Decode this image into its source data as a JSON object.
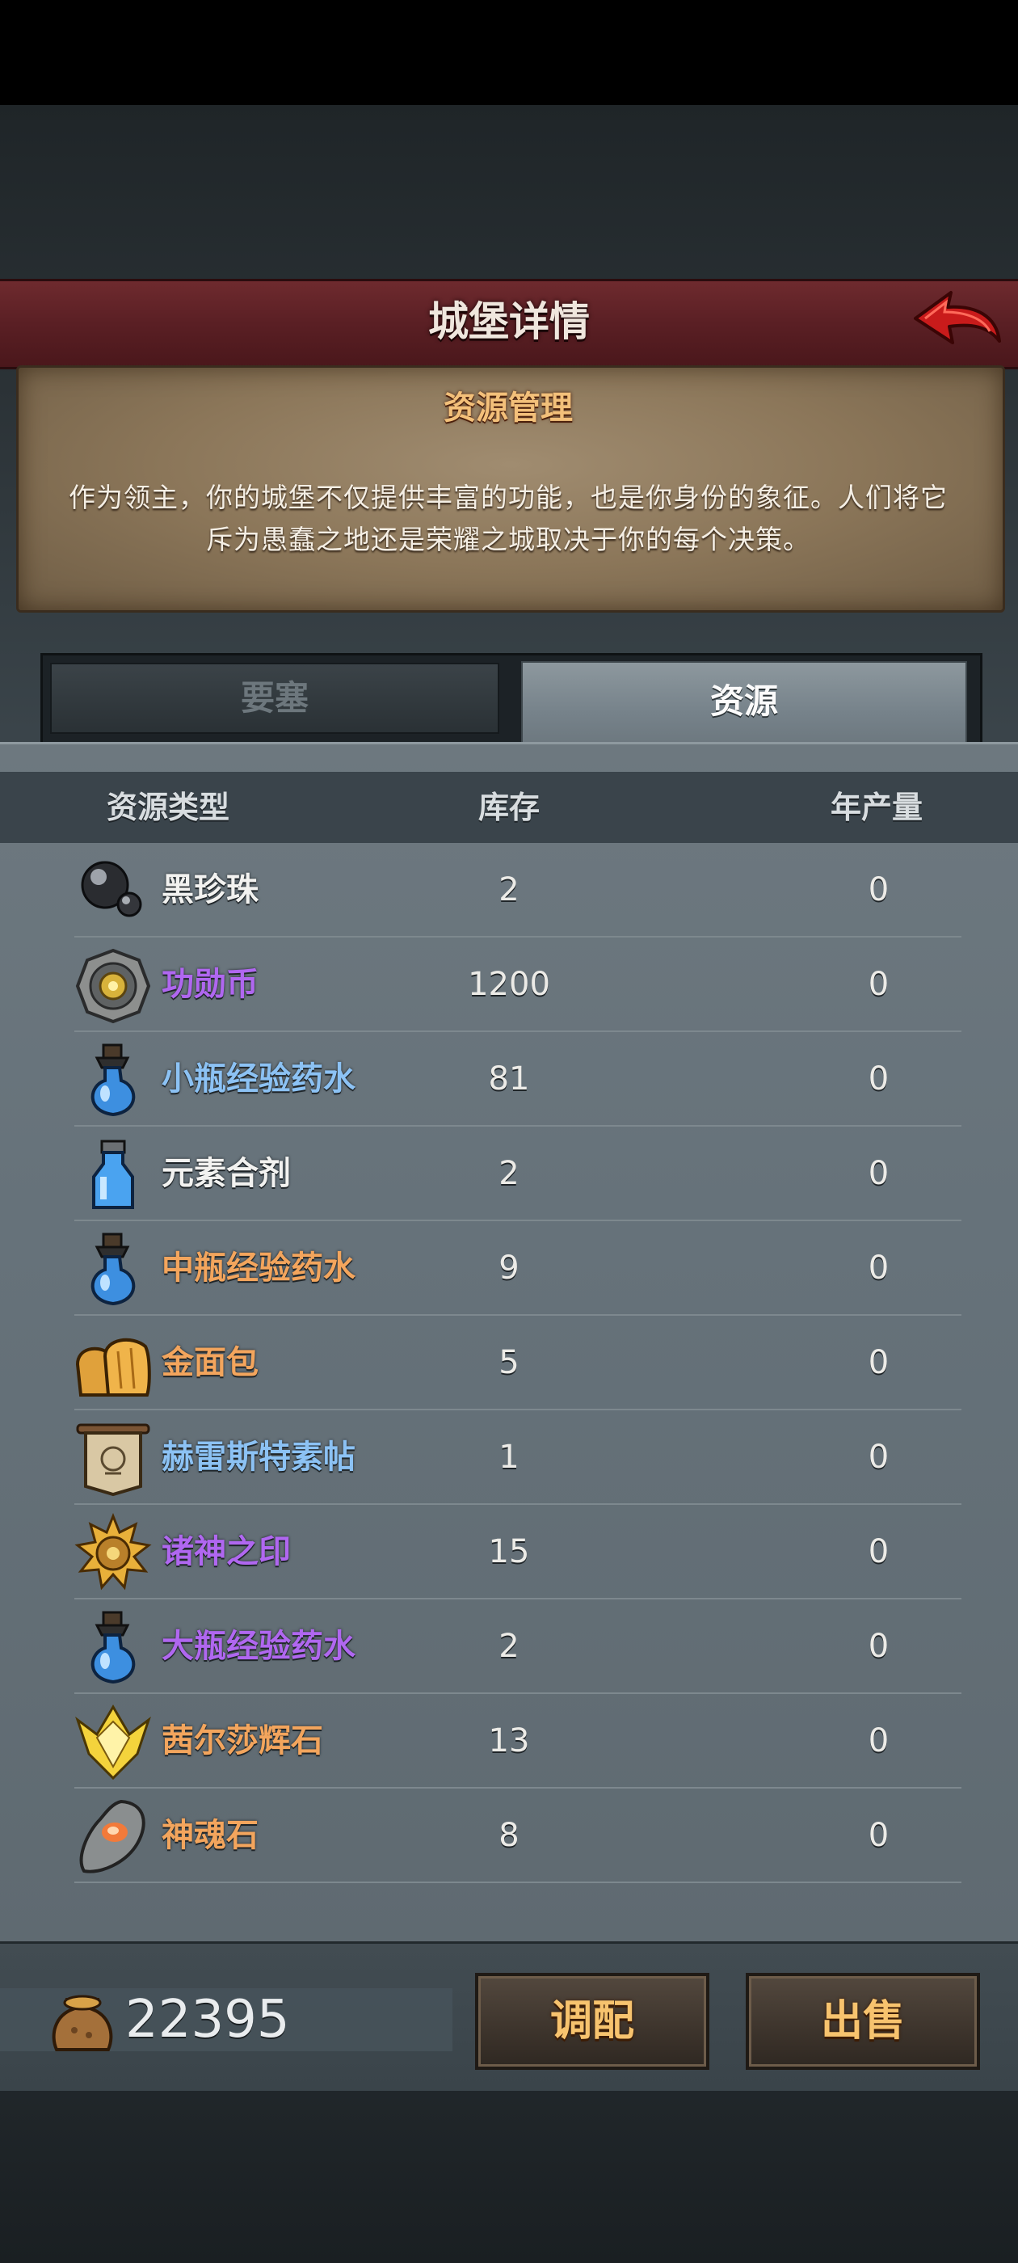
{
  "header": {
    "title": "城堡详情"
  },
  "info_panel": {
    "heading": "资源管理",
    "description": "作为领主，你的城堡不仅提供丰富的功能，也是你身份的象征。人们将它斥为愚蠢之地还是荣耀之城取决于你的每个决策。"
  },
  "tabs": [
    {
      "label": "要塞",
      "active": false
    },
    {
      "label": "资源",
      "active": true
    }
  ],
  "table": {
    "columns": [
      "资源类型",
      "库存",
      "年产量"
    ],
    "rows": [
      {
        "name": "黑珍珠",
        "stock": "2",
        "output": "0",
        "icon": "black-pearl-icon",
        "color": "#f2f2f0"
      },
      {
        "name": "功勋币",
        "stock": "1200",
        "output": "0",
        "icon": "merit-coin-icon",
        "color": "#b067f0"
      },
      {
        "name": "小瓶经验药水",
        "stock": "81",
        "output": "0",
        "icon": "small-potion-icon",
        "color": "#8cc2f4"
      },
      {
        "name": "元素合剂",
        "stock": "2",
        "output": "0",
        "icon": "elemental-flask-icon",
        "color": "#f2f2f0"
      },
      {
        "name": "中瓶经验药水",
        "stock": "9",
        "output": "0",
        "icon": "medium-potion-icon",
        "color": "#f3a55d"
      },
      {
        "name": "金面包",
        "stock": "5",
        "output": "0",
        "icon": "golden-bread-icon",
        "color": "#f3a55d"
      },
      {
        "name": "赫雷斯特素帖",
        "stock": "1",
        "output": "0",
        "icon": "scroll-banner-icon",
        "color": "#8cc2f4"
      },
      {
        "name": "诸神之印",
        "stock": "15",
        "output": "0",
        "icon": "gods-seal-icon",
        "color": "#b067f0"
      },
      {
        "name": "大瓶经验药水",
        "stock": "2",
        "output": "0",
        "icon": "large-potion-icon",
        "color": "#b067f0"
      },
      {
        "name": "茜尔莎辉石",
        "stock": "13",
        "output": "0",
        "icon": "radiant-crystal-icon",
        "color": "#f3a55d"
      },
      {
        "name": "神魂石",
        "stock": "8",
        "output": "0",
        "icon": "soul-stone-icon",
        "color": "#f3a55d"
      }
    ]
  },
  "footer": {
    "gold_amount": "22395",
    "adjust_label": "调配",
    "sell_label": "出售"
  }
}
